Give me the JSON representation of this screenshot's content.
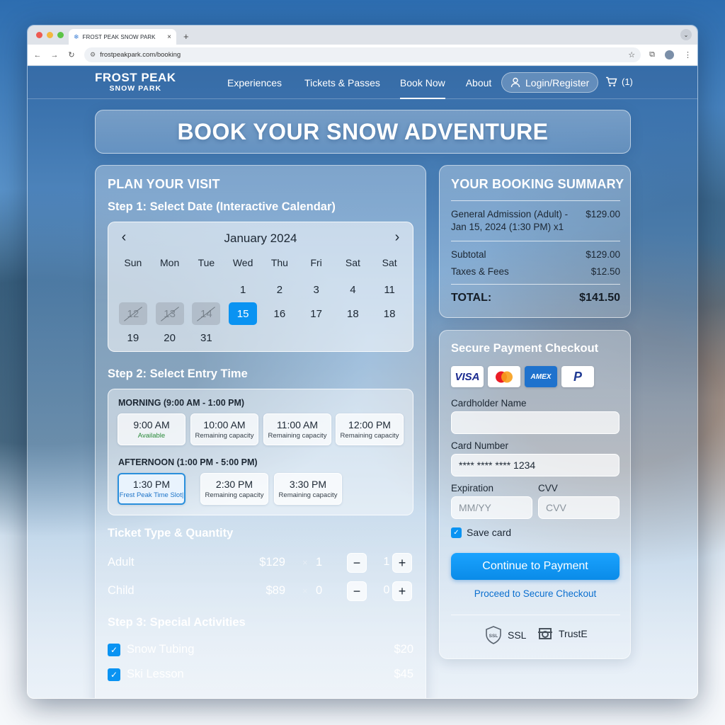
{
  "browser": {
    "tab_title": "FROST PEAK SNOW PARK",
    "tab_close": "×",
    "new_tab": "+",
    "url": "frostpeakpark.com/booking",
    "nav_icons": [
      "back-icon",
      "forward-icon",
      "reload-icon"
    ]
  },
  "header": {
    "brand_line1": "FROST PEAK",
    "brand_line2": "SNOW PARK",
    "nav": [
      "Experiences",
      "Tickets & Passes",
      "Book Now",
      "About"
    ],
    "active_nav": "Book Now",
    "login_label": "Login/Register",
    "cart_count": "(1)"
  },
  "hero": {
    "title": "BOOK YOUR SNOW ADVENTURE"
  },
  "plan": {
    "title": "PLAN YOUR VISIT",
    "step1_title": "Step 1: Select Date (Interactive Calendar)",
    "calendar": {
      "month": "January 2024",
      "prev": "‹",
      "next": "›",
      "days_of_week": [
        "Sun",
        "Mon",
        "Tue",
        "Wed",
        "Thu",
        "Fri",
        "Sat",
        "Sat"
      ],
      "selected_day": "15",
      "rows": [
        [
          "",
          "",
          "",
          "1",
          "2",
          "3",
          "4",
          "11"
        ],
        [
          "12",
          "13",
          "14",
          "15",
          "16",
          "17",
          "18",
          "18"
        ],
        [
          "19",
          "20",
          "31",
          "",
          "",
          "",
          "",
          ""
        ]
      ],
      "disabled_days": [
        "12",
        "13",
        "14"
      ]
    },
    "step2_title": "Step 2: Select Entry Time",
    "morning_label": "MORNING (9:00 AM - 1:00 PM)",
    "afternoon_label": "AFTERNOON (1:00 PM - 5:00 PM)",
    "morning_slots": [
      {
        "time": "9:00 AM",
        "status": "Available"
      },
      {
        "time": "10:00 AM",
        "status": "Remaining capacity"
      },
      {
        "time": "11:00 AM",
        "status": "Remaining capacity"
      },
      {
        "time": "12:00 PM",
        "status": "Remaining capacity"
      }
    ],
    "afternoon_slots": [
      {
        "time": "1:30 PM",
        "status": "Frest Peak Time Slot|"
      },
      {
        "time": "2:30 PM",
        "status": "Remaining capacity"
      },
      {
        "time": "3:30 PM",
        "status": "Remaining capacity"
      }
    ],
    "tickets_title": "Ticket Type & Quantity",
    "tickets": [
      {
        "name": "Adult",
        "price": "$129",
        "times": "×",
        "qty": "1"
      },
      {
        "name": "Child",
        "price": "$89",
        "times": "×",
        "qty": "0"
      }
    ],
    "stepper_minus": "−",
    "stepper_plus": "+",
    "step3_title": "Step 3: Special Activities",
    "activities": [
      {
        "name": "Snow Tubing",
        "price": "$20",
        "checked": true
      },
      {
        "name": "Ski Lesson",
        "price": "$45",
        "checked": true
      }
    ]
  },
  "summary": {
    "title": "YOUR BOOKING SUMMARY",
    "item_line1": "General Admission (Adult) -",
    "item_line2": "Jan 15, 2024 (1:30 PM) x1",
    "item_price": "$129.00",
    "subtotal_label": "Subtotal",
    "subtotal": "$129.00",
    "taxes_label": "Taxes & Fees",
    "taxes": "$12.50",
    "total_label": "TOTAL:",
    "total": "$141.50"
  },
  "payment": {
    "title": "Secure Payment Checkout",
    "card_brands": [
      "VISA",
      "Mastercard",
      "AMEX",
      "PayPal"
    ],
    "visa_text": "VISA",
    "amex_text": "AMEX",
    "paypal_text": "P",
    "cardholder_label": "Cardholder Name",
    "cardholder_value": "",
    "card_number_label": "Card Number",
    "card_number_value": "**** **** **** 1234",
    "expiration_label": "Expiration",
    "expiration_placeholder": "MM/YY",
    "cvv_label": "CVV",
    "cvv_placeholder": "CVV",
    "save_card_label": "Save card",
    "continue_label": "Continue to Payment",
    "secure_link": "Proceed to Secure Checkout",
    "ssl_label": "SSL",
    "ssl_badge": "SSL",
    "truste_label": "TrustE"
  },
  "colors": {
    "accent": "#0a93f2",
    "link": "#0b6fcf",
    "available": "#2a8a3a"
  }
}
